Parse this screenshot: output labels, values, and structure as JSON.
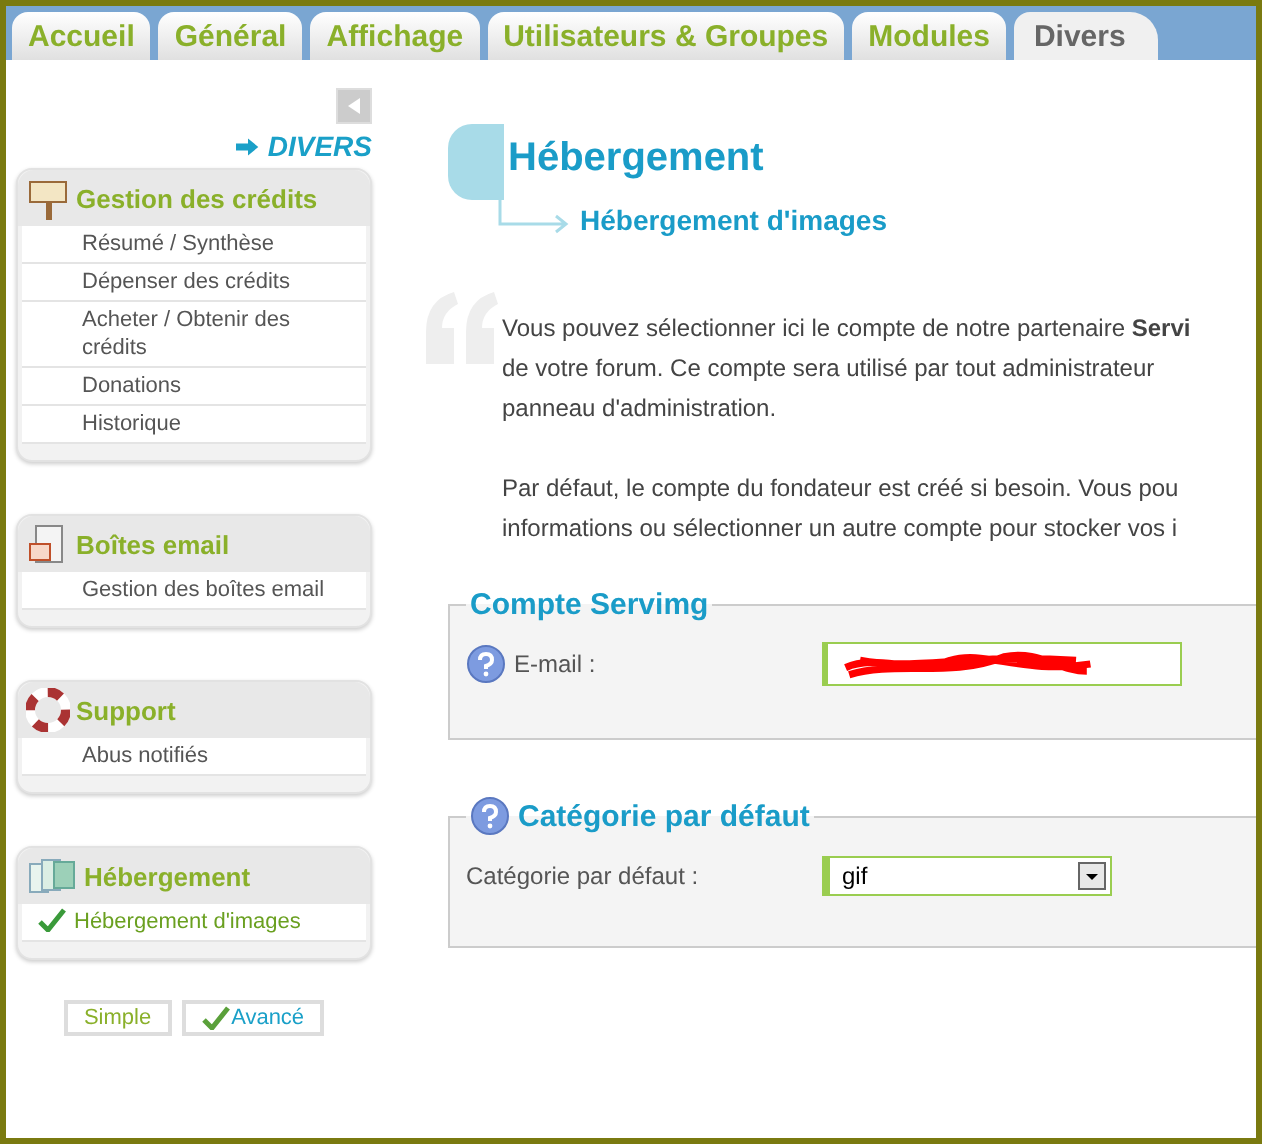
{
  "tabs": [
    {
      "label": "Accueil",
      "selected": false
    },
    {
      "label": "Général",
      "selected": false
    },
    {
      "label": "Affichage",
      "selected": false
    },
    {
      "label": "Utilisateurs & Groupes",
      "selected": false
    },
    {
      "label": "Modules",
      "selected": false
    },
    {
      "label": "Divers",
      "selected": true
    }
  ],
  "sidebar": {
    "section_title": "DIVERS",
    "groups": [
      {
        "title": "Gestion des crédits",
        "kind": "credits",
        "items": [
          {
            "label": "Résumé / Synthèse",
            "selected": false
          },
          {
            "label": "Dépenser des crédits",
            "selected": false
          },
          {
            "label": "Acheter / Obtenir des crédits",
            "selected": false
          },
          {
            "label": "Donations",
            "selected": false
          },
          {
            "label": "Historique",
            "selected": false
          }
        ]
      },
      {
        "title": "Boîtes email",
        "kind": "mail",
        "items": [
          {
            "label": "Gestion des boîtes email",
            "selected": false
          }
        ]
      },
      {
        "title": "Support",
        "kind": "support",
        "items": [
          {
            "label": "Abus notifiés",
            "selected": false
          }
        ]
      },
      {
        "title": "Hébergement",
        "kind": "images",
        "items": [
          {
            "label": "Hébergement d'images",
            "selected": true
          }
        ]
      }
    ],
    "modes": [
      {
        "label": "Simple",
        "selected": false
      },
      {
        "label": "Avancé",
        "selected": true
      }
    ]
  },
  "main": {
    "title": "Hébergement",
    "subtitle": "Hébergement d'images",
    "paragraphs": [
      [
        "Vous pouvez sélectionner ici le compte de notre partenaire **Servi**",
        "de votre forum. Ce compte sera utilisé par tout administrateur",
        "panneau d'administration."
      ],
      [
        "Par défaut, le compte du fondateur est créé si besoin. Vous pou",
        "informations ou sélectionner un autre compte pour stocker vos i"
      ]
    ],
    "fieldsets": [
      {
        "legend": "Compte Servimg",
        "legend_help": false,
        "fields": [
          {
            "kind": "text",
            "label": "E-mail :",
            "help": true,
            "redacted": true
          }
        ]
      },
      {
        "legend": "Catégorie par défaut",
        "legend_help": true,
        "fields": [
          {
            "kind": "select",
            "label": "Catégorie par défaut :",
            "help": false,
            "value": "gif"
          }
        ]
      }
    ]
  }
}
